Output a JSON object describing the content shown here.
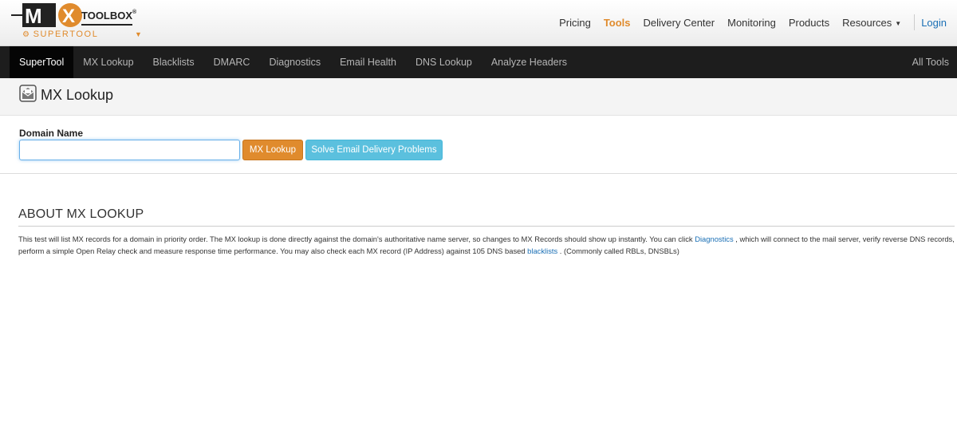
{
  "brand": {
    "logo_mx": "MX",
    "logo_toolbox": "TOOLBOX",
    "logo_reg": "®",
    "logo_sub": "SUPERTOOL",
    "gear_icon": "gear-icon",
    "accent": "#e08b2d"
  },
  "topnav": {
    "items": [
      {
        "label": "Pricing",
        "active": false
      },
      {
        "label": "Tools",
        "active": true
      },
      {
        "label": "Delivery Center",
        "active": false
      },
      {
        "label": "Monitoring",
        "active": false
      },
      {
        "label": "Products",
        "active": false
      },
      {
        "label": "Resources",
        "active": false
      }
    ],
    "login": "Login"
  },
  "darknav": {
    "items": [
      "SuperTool",
      "MX Lookup",
      "Blacklists",
      "DMARC",
      "Diagnostics",
      "Email Health",
      "DNS Lookup",
      "Analyze Headers"
    ],
    "all_tools": "All Tools"
  },
  "page": {
    "title": "MX Lookup",
    "title_icon": "envelope-icon"
  },
  "form": {
    "label": "Domain Name",
    "input_value": "",
    "input_placeholder": "",
    "lookup_button": "MX Lookup",
    "solve_button": "Solve Email Delivery Problems",
    "orange": "#e08b2d",
    "blue": "#5bc0de"
  },
  "about": {
    "heading": "ABOUT MX LOOKUP",
    "p1": "This test will list MX records for a domain in priority order. The MX lookup is done directly against the domain's authoritative name server, so changes to MX Records should show up instantly. You can click ",
    "link1": "Diagnostics",
    "p2": " , which will connect to the mail server, verify reverse DNS records, perform a simple Open Relay check and measure response time performance. You may also check each MX record (IP Address) against 105 DNS based ",
    "link2": "blacklists",
    "p3": " . (Commonly called RBLs, DNSBLs)"
  }
}
